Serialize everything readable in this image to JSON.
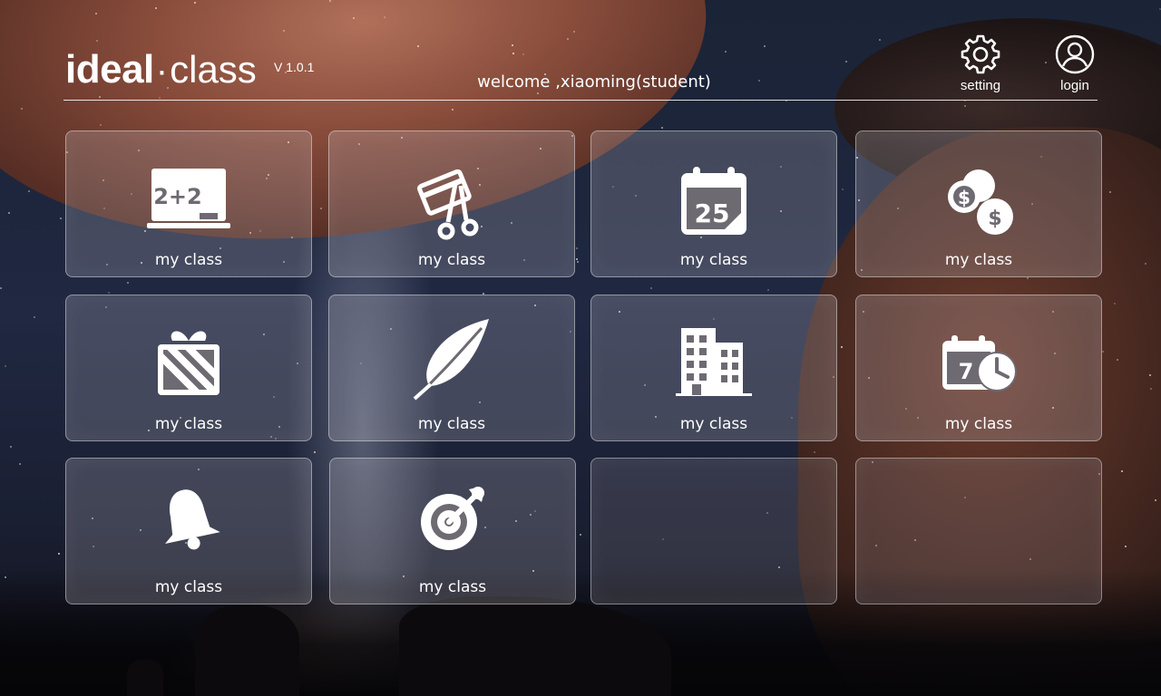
{
  "header": {
    "logo": {
      "part1": "ideal",
      "separator": "·",
      "part2": "class"
    },
    "version": "V 1.0.1",
    "welcome": "welcome ,xiaoming(student)",
    "setting_label": "setting",
    "login_label": "login"
  },
  "tiles": [
    {
      "label": "my class",
      "icon": "chalkboard-icon"
    },
    {
      "label": "my class",
      "icon": "card-scissors-icon"
    },
    {
      "label": "my class",
      "icon": "calendar-icon",
      "icon_text": "25"
    },
    {
      "label": "my class",
      "icon": "coins-icon",
      "icon_text": "$"
    },
    {
      "label": "my class",
      "icon": "gift-icon"
    },
    {
      "label": "my class",
      "icon": "feather-icon"
    },
    {
      "label": "my class",
      "icon": "building-icon"
    },
    {
      "label": "my class",
      "icon": "calendar-clock-icon",
      "icon_text": "7"
    },
    {
      "label": "my class",
      "icon": "bell-icon"
    },
    {
      "label": "my class",
      "icon": "target-icon"
    }
  ],
  "chalkboard_text": "2+2",
  "colors": {
    "text": "#ffffff",
    "tile_border": "#d8d8dc"
  }
}
